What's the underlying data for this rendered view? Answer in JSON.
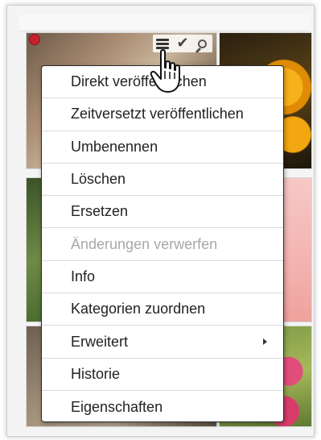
{
  "menu": {
    "items": [
      {
        "label": "Direkt veröffentlichen",
        "enabled": true,
        "has_submenu": false
      },
      {
        "label": "Zeitversetzt veröffentlichen",
        "enabled": true,
        "has_submenu": false
      },
      {
        "label": "Umbenennen",
        "enabled": true,
        "has_submenu": false
      },
      {
        "label": "Löschen",
        "enabled": true,
        "has_submenu": false
      },
      {
        "label": "Ersetzen",
        "enabled": true,
        "has_submenu": false
      },
      {
        "label": "Änderungen verwerfen",
        "enabled": false,
        "has_submenu": false
      },
      {
        "label": "Info",
        "enabled": true,
        "has_submenu": false
      },
      {
        "label": "Kategorien zuordnen",
        "enabled": true,
        "has_submenu": false
      },
      {
        "label": "Erweitert",
        "enabled": true,
        "has_submenu": true
      },
      {
        "label": "Historie",
        "enabled": true,
        "has_submenu": false
      },
      {
        "label": "Eigenschaften",
        "enabled": true,
        "has_submenu": false
      }
    ]
  },
  "toolbar": {
    "icons": [
      "menu-icon",
      "checkmark-icon",
      "zoom-icon"
    ],
    "check_glyph": "✔"
  },
  "status_color": "#c9202e",
  "cursor": "hand-pointer-icon"
}
